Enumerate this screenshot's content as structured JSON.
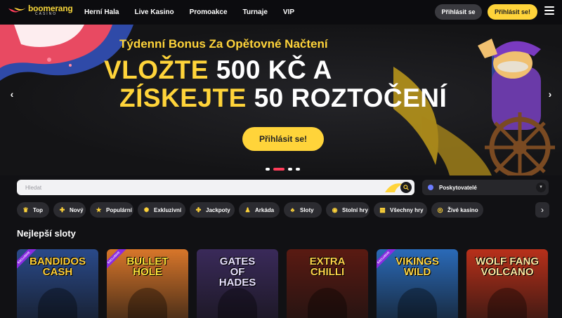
{
  "header": {
    "logo_top": "boomerang",
    "logo_bottom": "CASINO",
    "nav": [
      "Herní Hala",
      "Live Kasino",
      "Promoakce",
      "Turnaje",
      "VIP"
    ],
    "login_label": "Přihlásit se",
    "register_label": "Přihlásit se!"
  },
  "hero": {
    "subtitle": "Týdenní Bonus Za Opětovné Načtení",
    "line1_a": "VLOŽTE",
    "line1_b": "500 KČ A",
    "line2_a": "ZÍSKEJTE",
    "line2_b": "50 ROZTOČENÍ",
    "cta_label": "Přihlásit se!",
    "slide_count": 4,
    "active_slide": 2
  },
  "search": {
    "placeholder": "Hledat"
  },
  "providers": {
    "label": "Poskytovatelé"
  },
  "categories": [
    {
      "label": "Top",
      "icon": "crown-icon",
      "glyph": "♛"
    },
    {
      "label": "Nový",
      "icon": "plus-icon",
      "glyph": "✚"
    },
    {
      "label": "Populární",
      "icon": "star-icon",
      "glyph": "★"
    },
    {
      "label": "Exkluzivní",
      "icon": "gear-icon",
      "glyph": "✺"
    },
    {
      "label": "Jackpoty",
      "icon": "clover-icon",
      "glyph": "✤"
    },
    {
      "label": "Arkáda",
      "icon": "joystick-icon",
      "glyph": "♟"
    },
    {
      "label": "Sloty",
      "icon": "cherries-icon",
      "glyph": "♣"
    },
    {
      "label": "Stolní hry",
      "icon": "chip-icon",
      "glyph": "◉"
    },
    {
      "label": "Všechny hry",
      "icon": "grid-icon",
      "glyph": "▦"
    },
    {
      "label": "Živé kasino",
      "icon": "eye-icon",
      "glyph": "◎"
    }
  ],
  "section": {
    "title": "Nejlepší sloty"
  },
  "games": [
    {
      "name": "BANDIDOS\nCASH",
      "badge": "EXCLUSIVE",
      "bg": "#2a4a8a",
      "color": "#ffcf3a"
    },
    {
      "name": "BULLET\nHOLE",
      "badge": "EXCLUSIVE",
      "bg": "#d8762a",
      "color": "#ffe23a"
    },
    {
      "name": "GATES\nOF\nHADES",
      "badge": "",
      "bg": "#3a2a5a",
      "color": "#e8e0ff"
    },
    {
      "name": "EXTRA\nCHILLI",
      "badge": "",
      "bg": "#5a1a12",
      "color": "#ffd24a"
    },
    {
      "name": "VIKINGS\nWILD",
      "badge": "EXCLUSIVE",
      "bg": "#2a6ab8",
      "color": "#ffd84a"
    },
    {
      "name": "WOLF FANG\nVOLCANO",
      "badge": "",
      "bg": "#b8301a",
      "color": "#ffe6a0"
    }
  ]
}
